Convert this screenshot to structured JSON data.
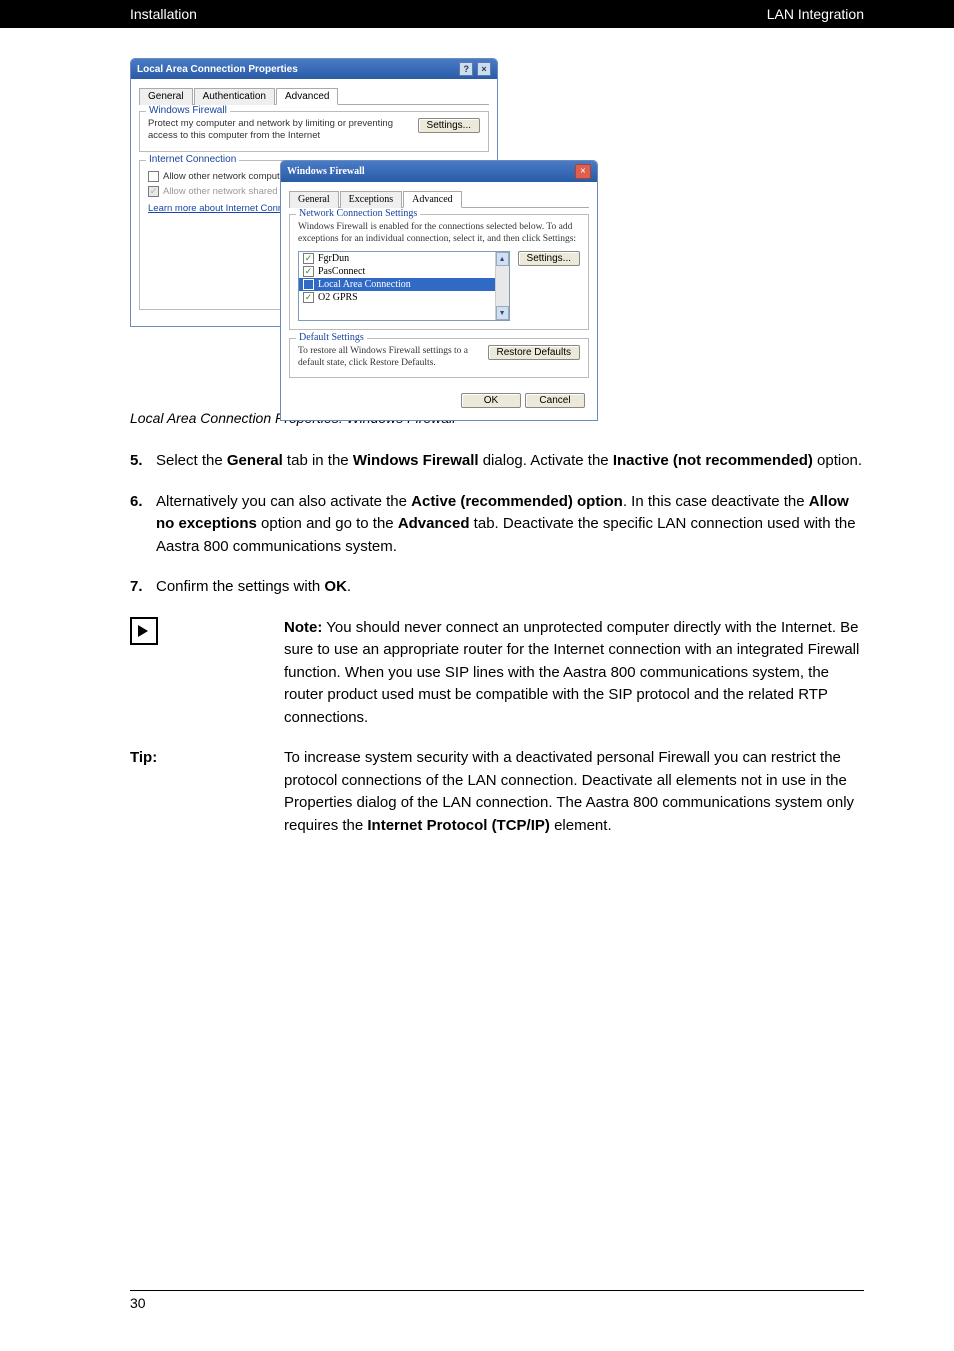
{
  "header": {
    "left": "Installation",
    "right": "LAN Integration"
  },
  "screenshot": {
    "outer_window": {
      "title": "Local Area Connection Properties",
      "tabs": {
        "general": "General",
        "auth": "Authentication",
        "advanced": "Advanced"
      },
      "firewall_section": {
        "legend": "Windows Firewall",
        "text": "Protect my computer and network by limiting or preventing access to this computer from the Internet",
        "button": "Settings..."
      },
      "ics_section": {
        "legend": "Internet Connection",
        "cb1": "Allow other network computer's Intern",
        "cb2": "Allow other network shared Internet c",
        "link": "Learn more about Internet Connection Sharing"
      }
    },
    "inner_window": {
      "title": "Windows Firewall",
      "tabs": {
        "general": "General",
        "exceptions": "Exceptions",
        "advanced": "Advanced"
      },
      "ncs": {
        "legend": "Network Connection Settings",
        "desc": "Windows Firewall is enabled for the connections selected below. To add exceptions for an individual connection, select it, and then click Settings:",
        "items": [
          "FgrDun",
          "PasConnect",
          "Local Area Connection",
          "O2 GPRS"
        ],
        "button": "Settings..."
      },
      "defaults": {
        "legend": "Default Settings",
        "desc": "To restore all Windows Firewall settings to a default state, click Restore Defaults.",
        "button": "Restore Defaults"
      },
      "ok": "OK",
      "cancel": "Cancel"
    }
  },
  "caption": "Local Area Connection Properties: Windows Firewall",
  "steps": {
    "s5": {
      "num": "5.",
      "text_a": "Select the ",
      "b1": "General",
      "text_b": " tab in the ",
      "b2": "Windows Firewall",
      "text_c": " dialog. Activate the ",
      "b3": "Inactive (not recommended)",
      "text_d": " option."
    },
    "s6": {
      "num": "6.",
      "text_a": "Alternatively you can also activate the ",
      "b1": "Active (recommended) option",
      "text_b": ". In this case deactivate the ",
      "b2": "Allow no exceptions",
      "text_c": " option and go to the ",
      "b3": "Advanced",
      "text_d": " tab. Deactivate the specific LAN connection used with the Aastra 800 communications system."
    },
    "s7": {
      "num": "7.",
      "text_a": "Confirm the settings with ",
      "b1": "OK",
      "text_b": "."
    }
  },
  "note": {
    "label": "Note:",
    "text": "  You should never connect an unprotected computer directly with the Internet. Be sure to use an appropriate router for the Internet connection with an integrated Firewall function. When you use SIP lines with the Aastra 800 communications system, the router product used must be compatible with the SIP protocol and the related RTP connections."
  },
  "tip": {
    "label": "Tip:",
    "text_a": "To increase system security with a deactivated personal Firewall you can restrict the protocol connections of the LAN connection. Deactivate all elements not in use in the Properties dialog of the LAN connection. The Aastra 800 communications system only requires the ",
    "b1": "Internet Protocol (TCP/IP)",
    "text_b": " element."
  },
  "page_number": "30"
}
